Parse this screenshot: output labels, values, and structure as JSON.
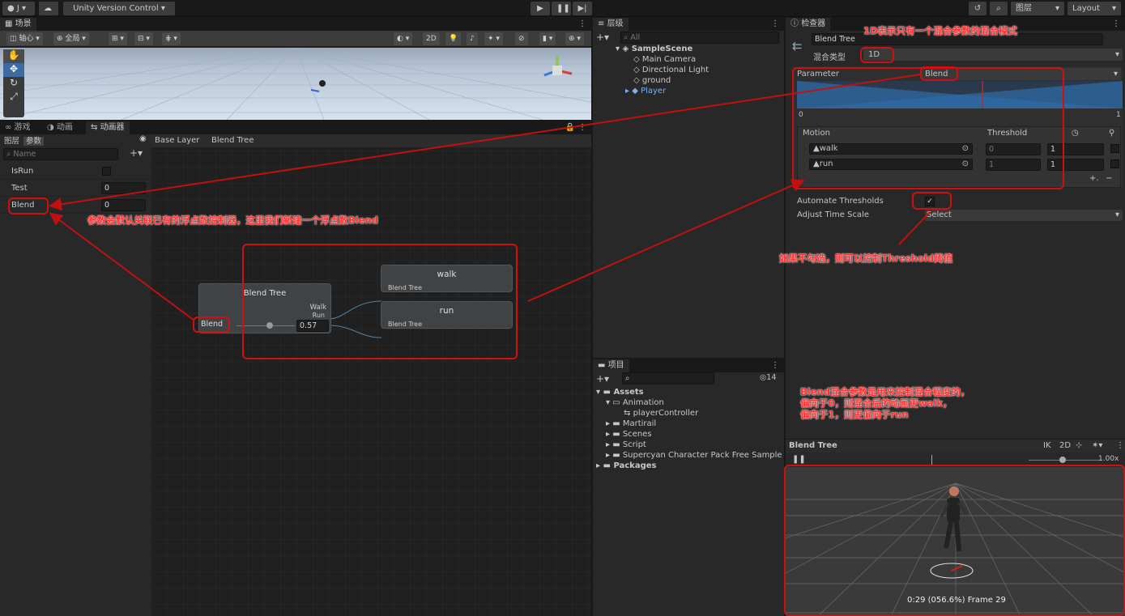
{
  "topbar": {
    "account": "J",
    "version_control": "Unity Version Control",
    "layers": "图层",
    "layout": "Layout"
  },
  "scene": {
    "tab": "场景",
    "pivot": "轴心",
    "global": "全局",
    "mode_2d": "2D"
  },
  "bottom_tabs": {
    "game": "游戏",
    "animation": "动画",
    "animator": "动画器"
  },
  "animator": {
    "tab_layers": "图层",
    "tab_params": "参数",
    "search_placeholder": "Name",
    "breadcrumb_base": "Base Layer",
    "breadcrumb_tree": "Blend Tree",
    "params": [
      {
        "name": "IsRun",
        "value": ""
      },
      {
        "name": "Test",
        "value": "0"
      },
      {
        "name": "Blend",
        "value": "0"
      }
    ],
    "node": {
      "title": "Blend Tree",
      "walk_port": "Walk",
      "run_port": "Run",
      "param": "Blend",
      "value": "0.57"
    },
    "child_walk": {
      "title": "walk",
      "sub": "Blend Tree"
    },
    "child_run": {
      "title": "run",
      "sub": "Blend Tree"
    }
  },
  "hierarchy": {
    "tab": "层级",
    "search": "All",
    "scene": "SampleScene",
    "items": [
      "Main Camera",
      "Directional Light",
      "ground",
      "Player"
    ]
  },
  "project": {
    "tab": "项目",
    "count": "14",
    "items": [
      "Assets",
      "Animation",
      "playerController",
      "Martirail",
      "Scenes",
      "Script",
      "Supercyan Character Pack Free Sample",
      "Packages"
    ]
  },
  "inspector": {
    "tab": "检查器",
    "name": "Blend Tree",
    "blend_type_label": "混合类型",
    "blend_type": "1D",
    "parameter_label": "Parameter",
    "parameter": "Blend",
    "axis_min": "0",
    "axis_max": "1",
    "motion_header": "Motion",
    "threshold_header": "Threshold",
    "motions": [
      {
        "name": "walk",
        "threshold": "0",
        "speed": "1"
      },
      {
        "name": "run",
        "threshold": "1",
        "speed": "1"
      }
    ],
    "automate_label": "Automate Thresholds",
    "adjust_label": "Adjust Time Scale",
    "adjust_value": "Select",
    "preview_title": "Blend Tree",
    "ik": "IK",
    "mode_2d": "2D",
    "speed": "1.00x",
    "frame_info": "0:29 (056.6%) Frame 29",
    "blend_pos": 0.57
  },
  "annotations": {
    "note_1d": "1D表示只有一个混合参数的混合模式",
    "note_params": "参数会默认关联已有的浮点数控制器，这里我们新建一个浮点数Blend",
    "note_threshold": "如果不勾选，则可以控制Threshold阈值",
    "note_blend_1": "Blend混合参数是用来控制混合程度的，",
    "note_blend_2": "偏向于0，则混合后的动画更walk，",
    "note_blend_3": "偏向于1，则更偏向于run"
  },
  "colors": {
    "accent_red": "#d01010",
    "blend_blue": "#2f6aa3"
  }
}
